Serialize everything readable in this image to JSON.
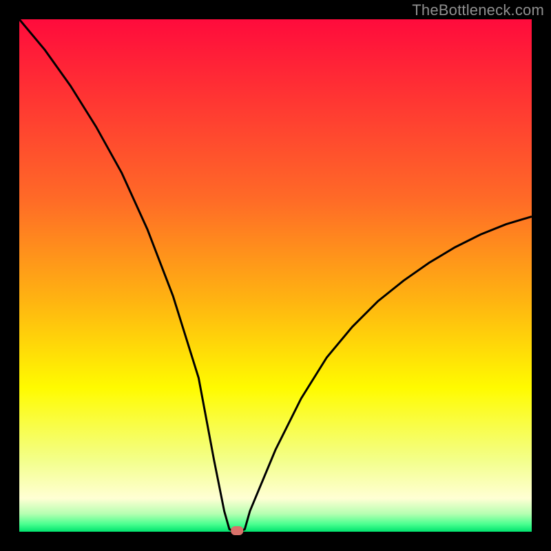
{
  "attribution": "TheBottleneck.com",
  "chart_data": {
    "type": "line",
    "title": "",
    "xlabel": "",
    "ylabel": "",
    "xlim": [
      0,
      100
    ],
    "ylim": [
      0,
      100
    ],
    "x": [
      0,
      5,
      10,
      15,
      20,
      25,
      30,
      35,
      38,
      40,
      41,
      42,
      43,
      44,
      45,
      50,
      55,
      60,
      65,
      70,
      75,
      80,
      85,
      90,
      95,
      100
    ],
    "values": [
      100,
      94,
      87,
      79,
      70,
      59,
      46,
      30,
      14,
      4,
      0.5,
      0,
      0,
      0.5,
      4,
      16,
      26,
      34,
      40,
      45,
      49,
      52.5,
      55.5,
      58,
      60,
      61.5
    ],
    "optimal_x": 42.5,
    "gradient_stops": [
      {
        "pos": 0.0,
        "color": "#ff0b3c"
      },
      {
        "pos": 0.35,
        "color": "#ff6a27"
      },
      {
        "pos": 0.55,
        "color": "#ffb411"
      },
      {
        "pos": 0.72,
        "color": "#fffb00"
      },
      {
        "pos": 0.86,
        "color": "#f3ff8a"
      },
      {
        "pos": 0.935,
        "color": "#ffffd4"
      },
      {
        "pos": 0.965,
        "color": "#b6ffb1"
      },
      {
        "pos": 0.985,
        "color": "#4bff90"
      },
      {
        "pos": 1.0,
        "color": "#00e36e"
      }
    ],
    "marker": {
      "color": "#d9716a"
    }
  }
}
